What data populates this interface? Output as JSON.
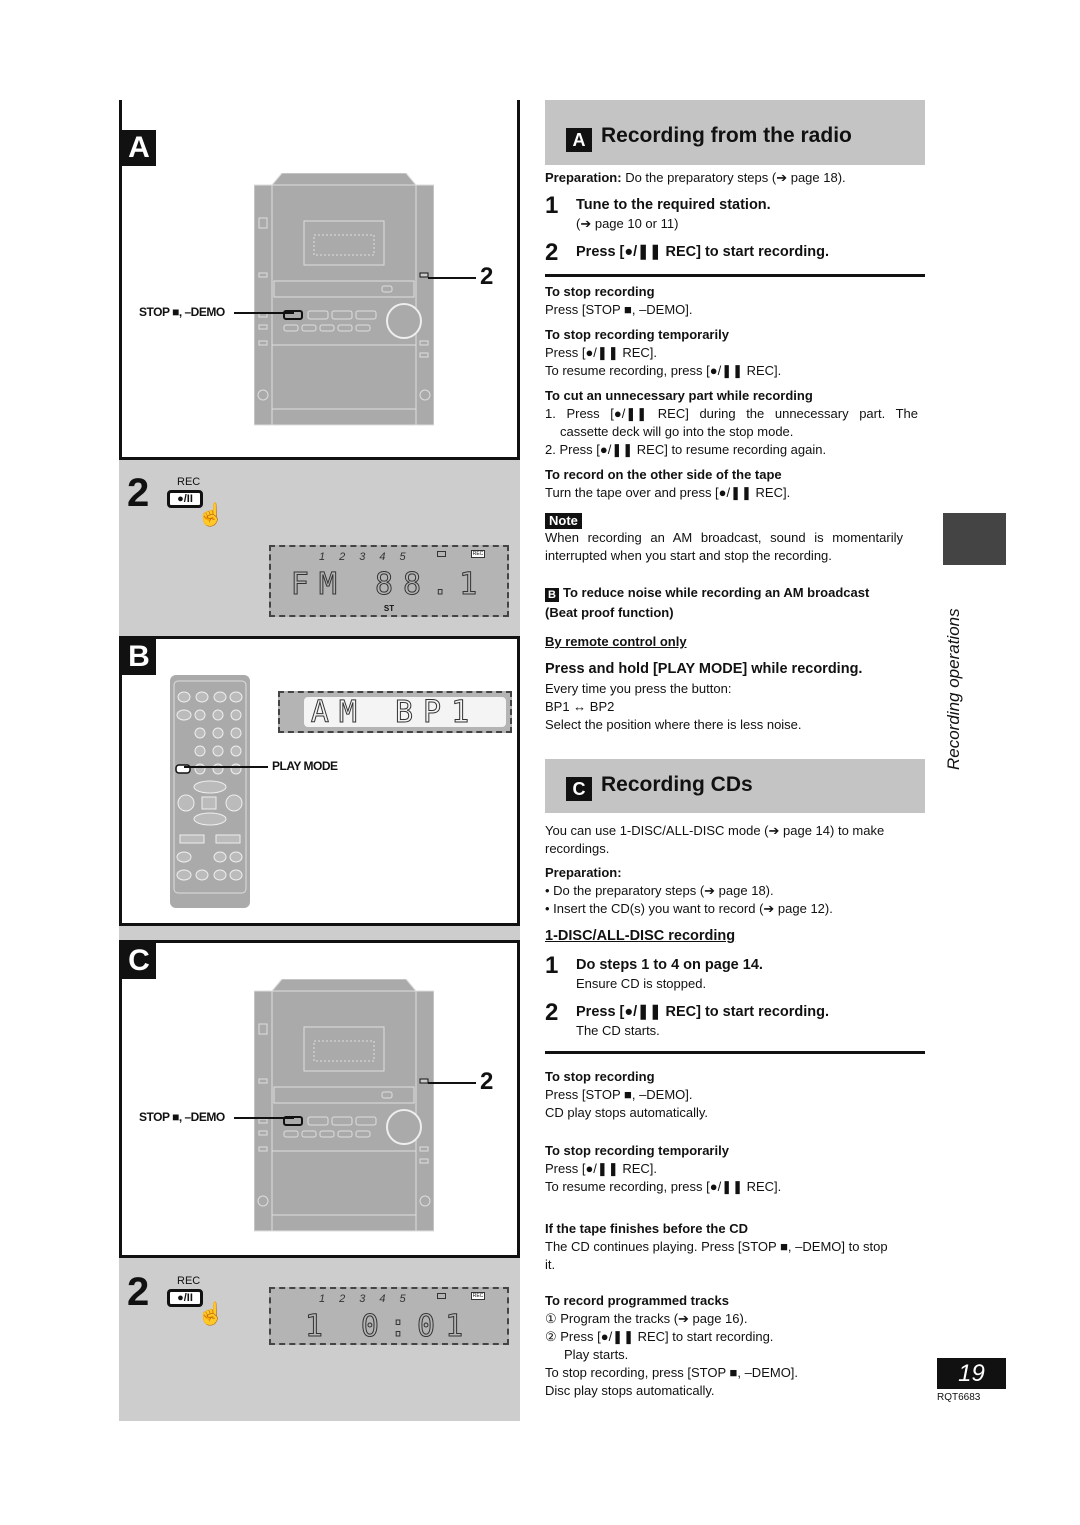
{
  "left": {
    "panel_a": {
      "letter": "A",
      "stop_label": "STOP ■, –DEMO",
      "callout_num": "2"
    },
    "step_a": {
      "num": "2",
      "rec_label": "REC",
      "rec_button": "●/II",
      "lcd_discs": "12345",
      "lcd_rec": "REC",
      "lcd_main": "FM  88.1",
      "lcd_sub": "ST"
    },
    "panel_b": {
      "letter": "B",
      "lcd_main": "AM  BP1",
      "play_mode_label": "PLAY MODE"
    },
    "panel_c": {
      "letter": "C",
      "stop_label": "STOP ■, –DEMO",
      "callout_num": "2"
    },
    "step_c": {
      "num": "2",
      "rec_label": "REC",
      "rec_button": "●/II",
      "lcd_discs": "12345",
      "lcd_rec": "REC",
      "lcd_main": "1    0:01"
    }
  },
  "radio": {
    "badge": "A",
    "title": "Recording from the radio",
    "prep_label": "Preparation:",
    "prep_text": " Do the preparatory steps (➔ page 18).",
    "step1_num": "1",
    "step1_title": "Tune to the required station.",
    "step1_sub": "(➔ page 10 or 11)",
    "step2_num": "2",
    "step2_title": "Press [●/❚❚ REC] to start recording.",
    "stop_h": "To stop recording",
    "stop_t": "Press [STOP ■, –DEMO].",
    "temp_h": "To stop recording temporarily",
    "temp_t1": "Press [●/❚❚ REC].",
    "temp_t2": "To resume recording, press  [●/❚❚ REC].",
    "cut_h": "To cut an unnecessary part while recording",
    "cut_t1": "1. Press [●/❚❚ REC] during the unnecessary part. The",
    "cut_t1b": "cassette deck will go into the stop mode.",
    "cut_t2": "2. Press [●/❚❚ REC] to resume recording again.",
    "other_h": "To record on the other side of the tape",
    "other_t": "Turn the tape over and press [●/❚❚ REC].",
    "note_label": "Note",
    "note_t1": "When recording an AM broadcast, sound is momentarily",
    "note_t2": "interrupted when you start and stop the recording.",
    "b_badge": "B",
    "b_h1": "To reduce noise while recording an AM broadcast",
    "b_h2": "(Beat proof function)",
    "remote_only": "By remote control only",
    "hold_title": "Press and hold [PLAY MODE] while recording.",
    "hold_t1": "Every time you press the button:",
    "hold_t2": "BP1 ↔ BP2",
    "hold_t3": "Select the position where there is less noise."
  },
  "cds": {
    "badge": "C",
    "title": "Recording CDs",
    "intro1": "You can use 1-DISC/ALL-DISC mode (➔ page 14) to make",
    "intro2": "recordings.",
    "prep_label": "Preparation:",
    "prep1": "• Do the preparatory steps (➔ page 18).",
    "prep2": "• Insert the CD(s) you want to record (➔ page 12).",
    "subhead": "1-DISC/ALL-DISC recording",
    "step1_num": "1",
    "step1_title": "Do steps 1 to 4 on page 14.",
    "step1_sub": "Ensure CD is stopped.",
    "step2_num": "2",
    "step2_title": "Press [●/❚❚ REC] to start recording.",
    "step2_sub": "The CD starts.",
    "stop_h": "To stop recording",
    "stop_t1": "Press [STOP ■, –DEMO].",
    "stop_t2": "CD play stops automatically.",
    "temp_h": "To stop recording temporarily",
    "temp_t1": "Press [●/❚❚ REC].",
    "temp_t2": "To resume recording, press  [●/❚❚ REC].",
    "tape_h": "If the tape finishes before the CD",
    "tape_t1": "The CD continues playing. Press [STOP ■, –DEMO] to stop",
    "tape_t2": "it.",
    "prog_h": "To record programmed tracks",
    "prog_t1": "① Program the tracks (➔ page 16).",
    "prog_t2": "② Press [●/❚❚ REC] to start recording.",
    "prog_t3": "Play starts.",
    "prog_t4": "To stop recording, press [STOP ■, –DEMO].",
    "prog_t5": "Disc play stops automatically."
  },
  "side": {
    "label": "Recording operations",
    "page_number": "19",
    "doc_code": "RQT6683"
  }
}
